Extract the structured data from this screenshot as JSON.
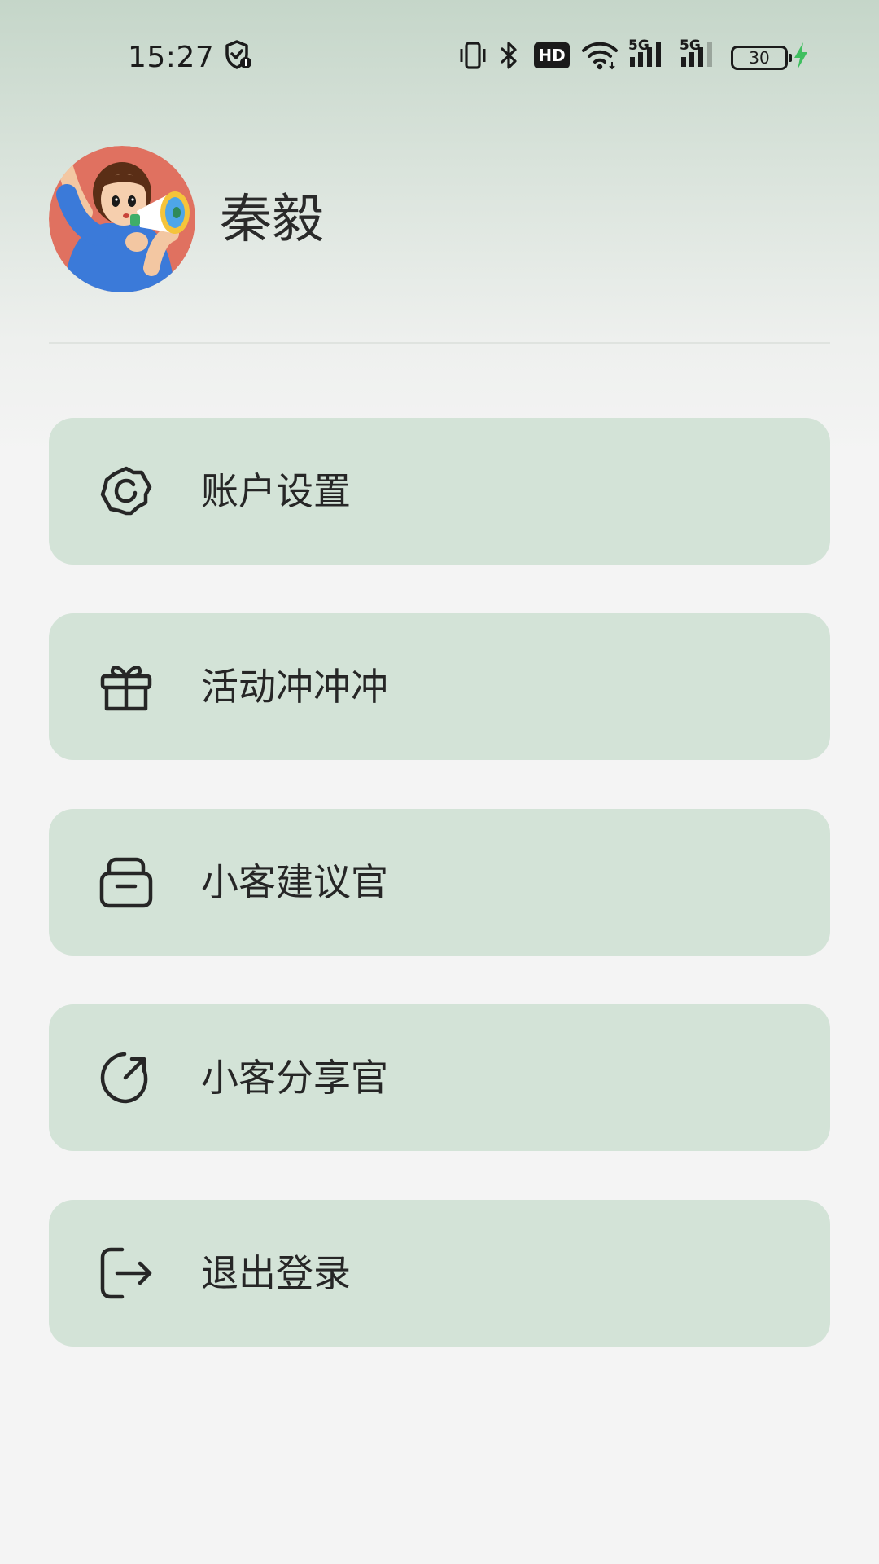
{
  "status_bar": {
    "time": "15:27",
    "battery_level": "30",
    "network_5g_1": "5G",
    "network_5g_2": "5G",
    "hd_badge": "HD",
    "icons": [
      "shield-notification-icon",
      "vibrate-icon",
      "bluetooth-icon",
      "hd-voice-icon",
      "wifi-icon",
      "signal-5g-icon",
      "signal-5g-icon",
      "battery-icon",
      "charging-icon"
    ],
    "colors": {
      "charging": "#3fbf5f",
      "text": "#1b1b1b"
    }
  },
  "profile": {
    "name": "秦毅",
    "avatar": "avatar-megaphone-illustration"
  },
  "menu": {
    "items": [
      {
        "label": "账户设置",
        "icon": "gear-icon"
      },
      {
        "label": "活动冲冲冲",
        "icon": "gift-icon"
      },
      {
        "label": "小客建议官",
        "icon": "inbox-icon"
      },
      {
        "label": "小客分享官",
        "icon": "share-arrow-icon"
      },
      {
        "label": "退出登录",
        "icon": "logout-icon"
      }
    ]
  },
  "theme": {
    "card_background": "#d3e3d7",
    "page_background": "#f4f4f4",
    "header_gradient_top": "#c5d6c9"
  }
}
